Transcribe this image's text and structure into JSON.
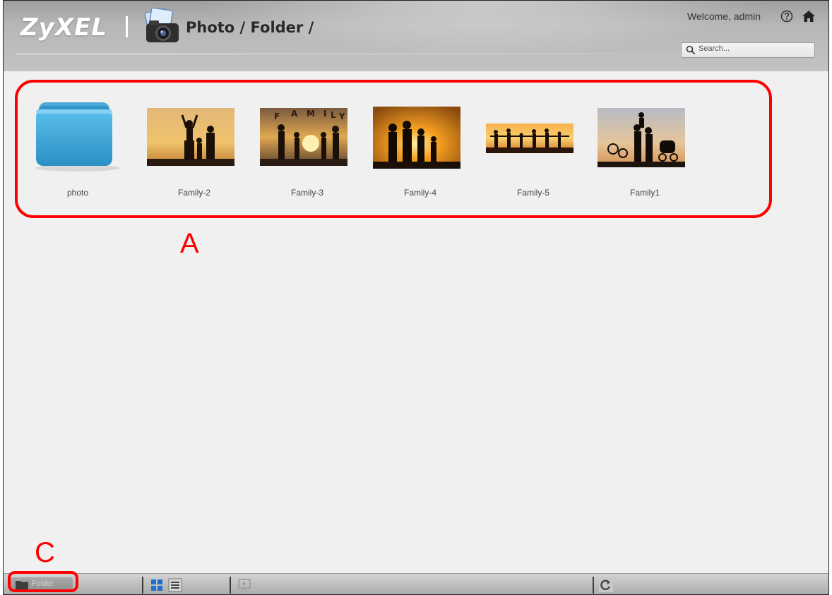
{
  "header": {
    "logo": "ZyXEL",
    "breadcrumb": "Photo / Folder /",
    "welcome": "Welcome, admin",
    "search_placeholder": "Search..."
  },
  "gallery": {
    "items": [
      {
        "label": "photo",
        "type": "folder"
      },
      {
        "label": "Family-2",
        "type": "image"
      },
      {
        "label": "Family-3",
        "type": "image"
      },
      {
        "label": "Family-4",
        "type": "image"
      },
      {
        "label": "Family-5",
        "type": "image"
      },
      {
        "label": "Family1",
        "type": "image"
      }
    ]
  },
  "annotations": {
    "a": "A",
    "c": "C"
  },
  "toolbar": {
    "folder_label": "Folder",
    "buttons": [
      "thumbnail-view-icon",
      "list-view-icon",
      "slideshow-icon",
      "refresh-icon"
    ]
  },
  "colors": {
    "annotation": "#ff0000",
    "folder_blue": "#3aa3d8",
    "thumb_view_blue": "#1e6fd0"
  }
}
